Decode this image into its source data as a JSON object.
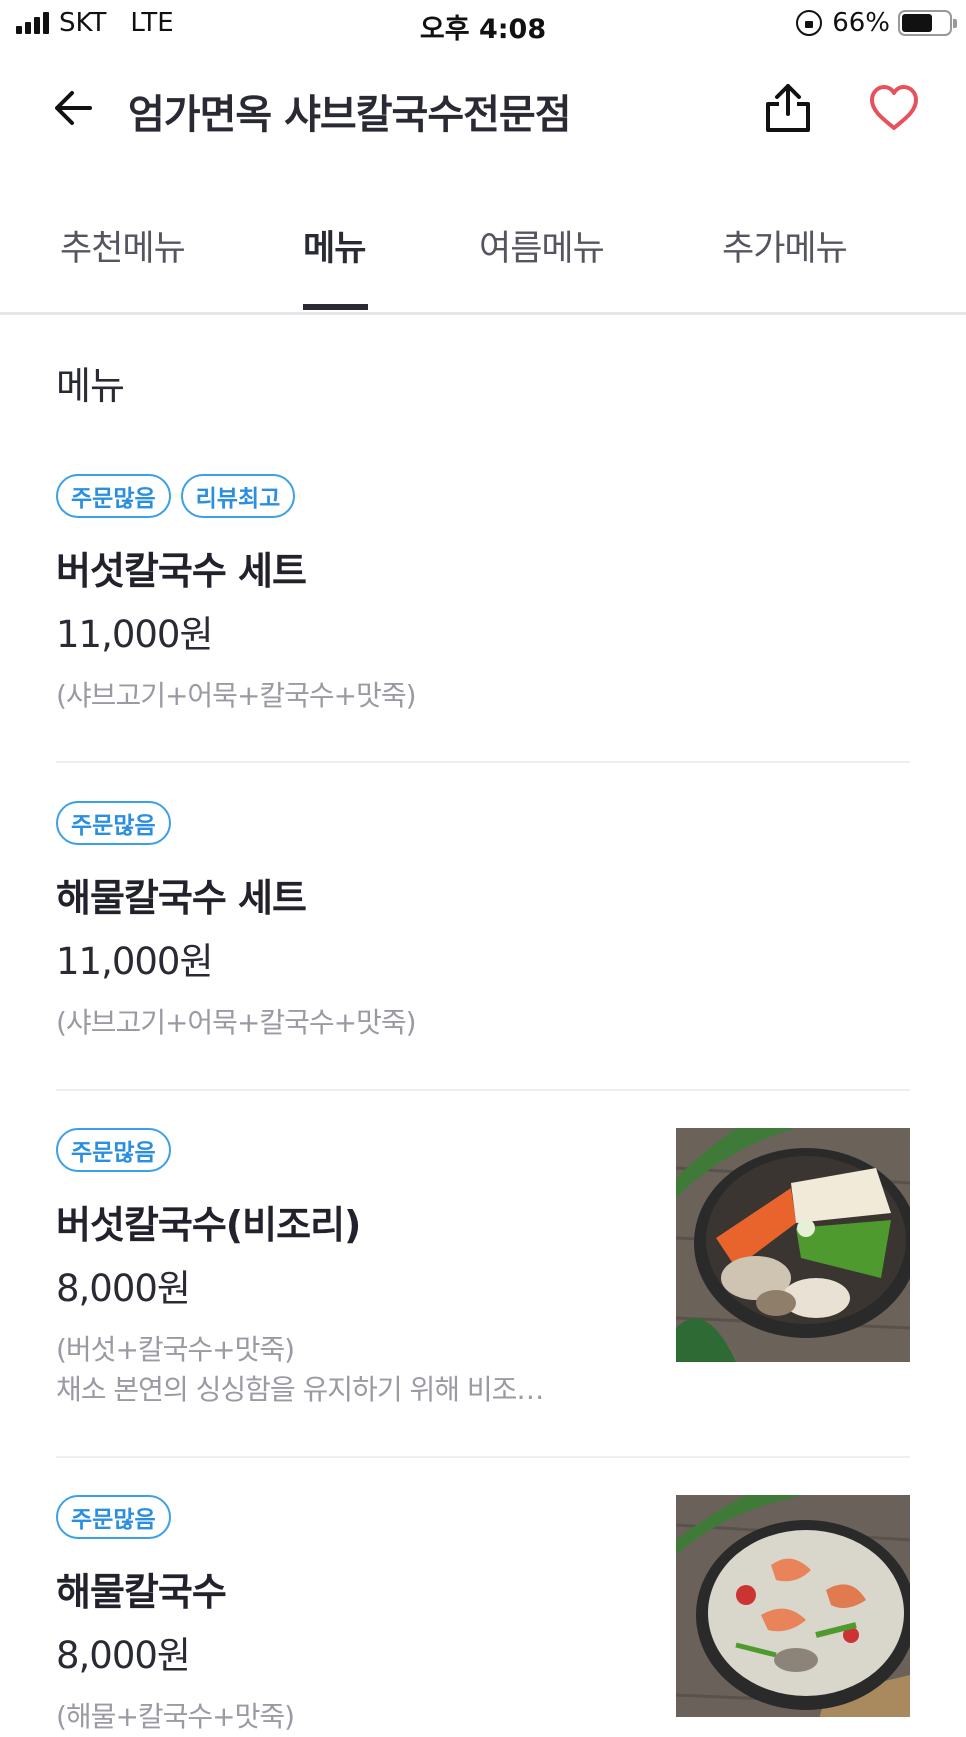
{
  "status_bar": {
    "carrier": "SKT",
    "network": "LTE",
    "time": "오후 4:08",
    "battery_percent_text": "66%",
    "battery_level": 0.66
  },
  "header": {
    "title": "엄가면옥 샤브칼국수전문점",
    "heart_color": "#e8505b"
  },
  "tabs": [
    {
      "label": "추천메뉴",
      "active": false
    },
    {
      "label": "메뉴",
      "active": true
    },
    {
      "label": "여름메뉴",
      "active": false
    },
    {
      "label": "추가메뉴",
      "active": false
    }
  ],
  "section": {
    "title": "메뉴"
  },
  "menu_items": [
    {
      "badges": [
        "주문많음",
        "리뷰최고"
      ],
      "name": "버섯칼국수 세트",
      "price": "11,000원",
      "desc1": "(샤브고기+어묵+칼국수+맛죽)",
      "desc2": "",
      "image": null
    },
    {
      "badges": [
        "주문많음"
      ],
      "name": "해물칼국수 세트",
      "price": "11,000원",
      "desc1": "(샤브고기+어묵+칼국수+맛죽)",
      "desc2": "",
      "image": null
    },
    {
      "badges": [
        "주문많음"
      ],
      "name": "버섯칼국수(비조리)",
      "price": "8,000원",
      "desc1": "(버섯+칼국수+맛죽)",
      "desc2": "채소 본연의 싱싱함을 유지하기 위해 비조…",
      "image": "mushroom-hotpot-photo"
    },
    {
      "badges": [
        "주문많음"
      ],
      "name": "해물칼국수",
      "price": "8,000원",
      "desc1": "(해물+칼국수+맛죽)",
      "desc2": "",
      "image": "seafood-hotpot-photo"
    }
  ],
  "colors": {
    "badge_blue": "#2b8fe0",
    "text_dark": "#2a2a35",
    "text_gray": "#9a9aa3"
  }
}
